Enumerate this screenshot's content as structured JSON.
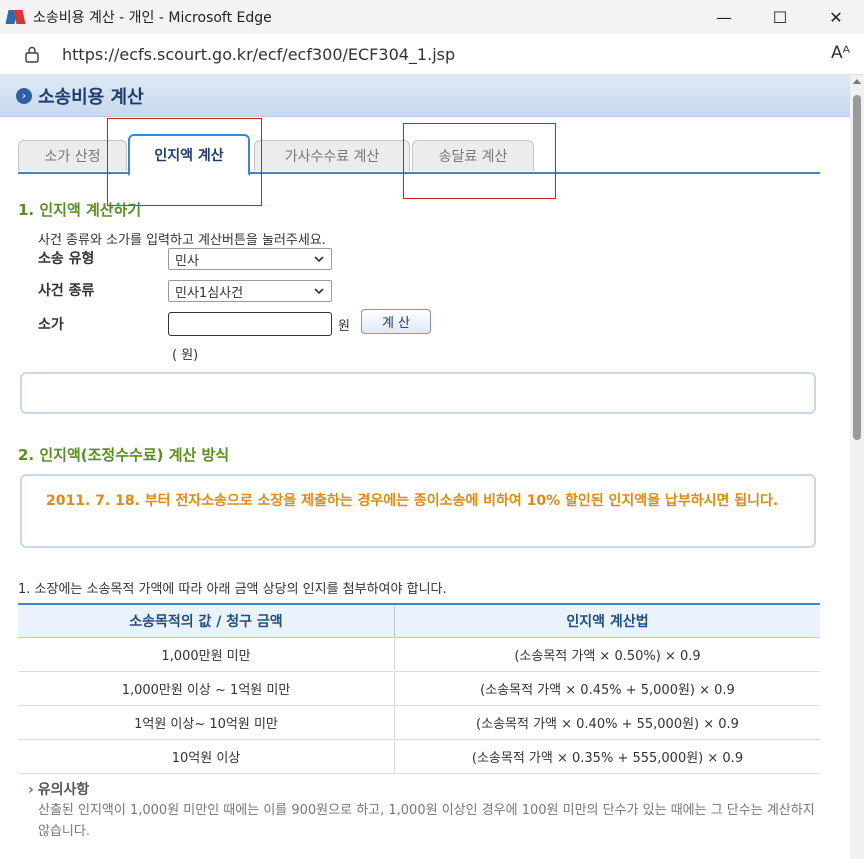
{
  "window": {
    "title": "소송비용 계산 - 개인 - Microsoft Edge",
    "minimize": "—",
    "maximize": "☐",
    "close": "✕"
  },
  "address": {
    "url": "https://ecfs.scourt.go.kr/ecf/ecf300/ECF304_1.jsp",
    "read_aloud": "Aᴬ"
  },
  "header": {
    "title": "소송비용 계산"
  },
  "tabs": [
    {
      "label": "소가 산정"
    },
    {
      "label": "인지액 계산"
    },
    {
      "label": "가사수수료 계산"
    },
    {
      "label": "송달료 계산"
    }
  ],
  "section1": {
    "title": "1. 인지액 계산하기",
    "instruction": "사건 종류와 소가를 입력하고 계산버튼을 눌러주세요.",
    "lawsuit_type_label": "소송 유형",
    "lawsuit_type_value": "민사",
    "case_type_label": "사건 종류",
    "case_type_value": "민사1심사건",
    "amount_label": "소가",
    "amount_value": "",
    "unit": "원",
    "calc_button": "계 산",
    "unit_hint": "( 원)"
  },
  "section2": {
    "title": "2. 인지액(조정수수료) 계산 방식",
    "notice": "2011. 7. 18. 부터 전자소송으로 소장을 제출하는 경우에는 종이소송에 비하여 10% 할인된 인지액을 납부하시면 됩니다.",
    "table_intro": "1. 소장에는 소송목적 가액에 따라 아래 금액 상당의 인지를 첨부하여야 합니다.",
    "table": {
      "headers": [
        "소송목적의 값 / 청구 금액",
        "인지액 계산법"
      ],
      "rows": [
        [
          "1,000만원 미만",
          "(소송목적 가액 × 0.50%) × 0.9"
        ],
        [
          "1,000만원 이상 ~ 1억원 미만",
          "(소송목적 가액 × 0.45% + 5,000원) × 0.9"
        ],
        [
          "1억원 이상~ 10억원 미만",
          "(소송목적 가액 × 0.40% + 55,000원) × 0.9"
        ],
        [
          "10억원 이상",
          "(소송목적 가액 × 0.35% + 555,000원) × 0.9"
        ]
      ]
    },
    "caution_title": "유의사항",
    "caution_text": "산출된 인지액이 1,000원 미만인 때에는 이를 900원으로 하고, 1,000원 이상인 경우에 100원 미만의 단수가 있는 때에는 그 단수는 계산하지 않습니다."
  },
  "colors": {
    "accent": "#3f86c9",
    "section_title": "#5a8e1e",
    "notice": "#e08a12",
    "highlight_box": "#d02020"
  }
}
